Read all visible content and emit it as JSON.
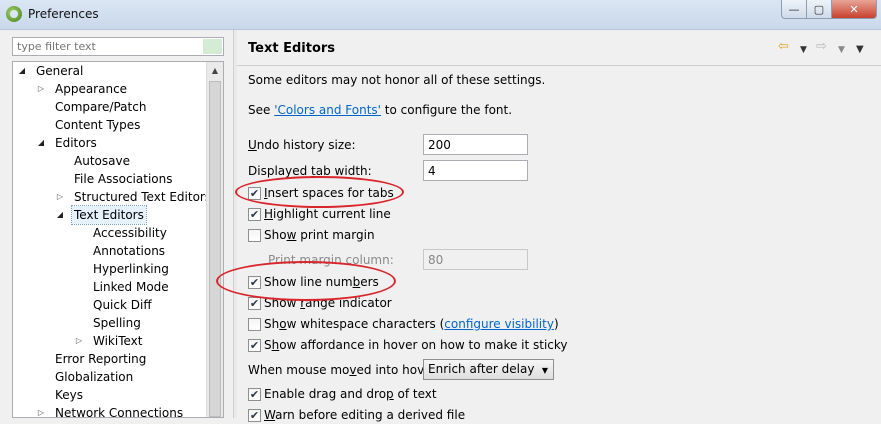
{
  "window": {
    "title": "Preferences",
    "controls": {
      "minimize": "—",
      "maximize": "▢",
      "close": "✕"
    }
  },
  "filter": {
    "placeholder": "type filter text"
  },
  "tree": {
    "items": [
      {
        "label": "General",
        "toggle": "◢"
      },
      {
        "label": "Appearance",
        "toggle": "▷"
      },
      {
        "label": "Compare/Patch",
        "toggle": ""
      },
      {
        "label": "Content Types",
        "toggle": ""
      },
      {
        "label": "Editors",
        "toggle": "◢"
      },
      {
        "label": "Autosave",
        "toggle": ""
      },
      {
        "label": "File Associations",
        "toggle": ""
      },
      {
        "label": "Structured Text Editors",
        "toggle": "▷"
      },
      {
        "label": "Text Editors",
        "toggle": "◢"
      },
      {
        "label": "Accessibility",
        "toggle": ""
      },
      {
        "label": "Annotations",
        "toggle": ""
      },
      {
        "label": "Hyperlinking",
        "toggle": ""
      },
      {
        "label": "Linked Mode",
        "toggle": ""
      },
      {
        "label": "Quick Diff",
        "toggle": ""
      },
      {
        "label": "Spelling",
        "toggle": ""
      },
      {
        "label": "WikiText",
        "toggle": "▷"
      },
      {
        "label": "Error Reporting",
        "toggle": ""
      },
      {
        "label": "Globalization",
        "toggle": ""
      },
      {
        "label": "Keys",
        "toggle": ""
      },
      {
        "label": "Network Connections",
        "toggle": "▷"
      }
    ],
    "scroll_up": "▲"
  },
  "page": {
    "title": "Text Editors",
    "nav_back": "⇦",
    "nav_dropdown": "▼",
    "nav_forward": "⇨",
    "menu": "▼",
    "note": "Some editors may not honor all of these settings.",
    "see_prefix": "See ",
    "see_link": "'Colors and Fonts'",
    "see_suffix": " to configure the font.",
    "undo_label": {
      "pre": "",
      "u": "U",
      "post": "ndo history size:"
    },
    "undo_value": "200",
    "tab_label": {
      "pre": "Displayed ",
      "u": "t",
      "post": "ab width:"
    },
    "tab_value": "4",
    "checkboxes": [
      {
        "pre": "",
        "u": "I",
        "post": "nsert spaces for tabs",
        "checked": true,
        "mark": "✔"
      },
      {
        "pre": "",
        "u": "H",
        "post": "ighlight current line",
        "checked": true,
        "mark": "✔"
      },
      {
        "pre": "Sho",
        "u": "w",
        "post": " print margin",
        "checked": false,
        "mark": ""
      }
    ],
    "print_margin_label": "Print margin column:",
    "print_margin_value": "80",
    "checkboxes2": [
      {
        "pre": "Show line num",
        "u": "b",
        "post": "ers",
        "checked": true,
        "mark": "✔"
      },
      {
        "pre": "Show ",
        "u": "r",
        "post": "ange indicator",
        "checked": true,
        "mark": "✔"
      },
      {
        "pre": "Sh",
        "u": "o",
        "post": "w whitespace characters",
        "checked": false,
        "mark": "",
        "link": "configure visibility",
        "open": "(",
        "close": ")"
      },
      {
        "pre": "S",
        "u": "h",
        "post": "ow affordance in hover on how to make it sticky",
        "checked": true,
        "mark": "✔"
      }
    ],
    "hover_label": {
      "pre": "When mouse mo",
      "u": "v",
      "post": "ed into hover:"
    },
    "hover_value": "Enrich after delay",
    "combo_arrow": "▼",
    "checkboxes3": [
      {
        "pre": "Enable drag and dro",
        "u": "p",
        "post": " of text",
        "checked": true,
        "mark": "✔"
      },
      {
        "pre": "",
        "u": "W",
        "post": "arn before editing a derived file",
        "checked": true,
        "mark": "✔"
      }
    ],
    "highlight_color": "#d9262c"
  }
}
